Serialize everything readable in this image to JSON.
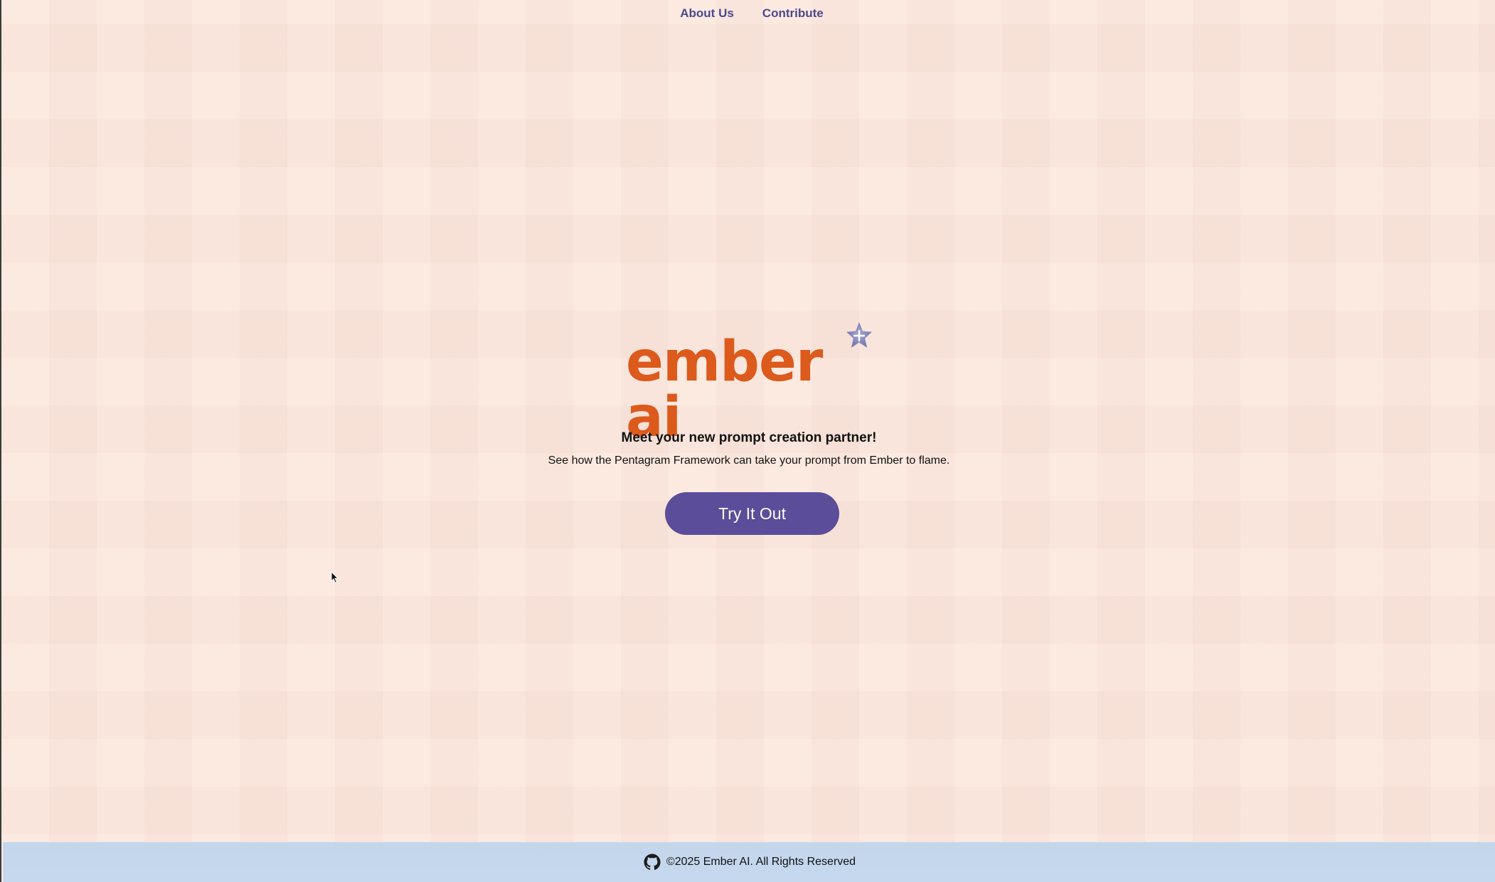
{
  "nav": {
    "about_label": "About Us",
    "contribute_label": "Contribute"
  },
  "hero": {
    "logo_text": "ember ai",
    "logo_icon": "sparkle-star-icon",
    "tagline": "Meet your new prompt creation partner!",
    "subline": "See how the Pentagram Framework can take your prompt from Ember to flame.",
    "cta_label": "Try It Out"
  },
  "footer": {
    "icon": "github-icon",
    "copyright": "©2025 Ember AI. All Rights Reserved"
  },
  "colors": {
    "background": "#fce6dc",
    "brand_orange": "#dc5a1c",
    "button_purple": "#5b4d99",
    "nav_link": "#4a4a8c",
    "footer_bg": "#c3d6ec"
  }
}
